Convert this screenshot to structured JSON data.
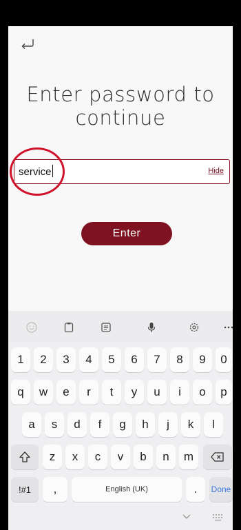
{
  "screen": {
    "title": "Enter password to continue"
  },
  "password_field": {
    "value": "service",
    "toggle_label": "Hide"
  },
  "enter_button": {
    "label": "Enter"
  },
  "keyboard": {
    "toolbar_icons": [
      "emoji-icon",
      "clipboard-icon",
      "notes-icon",
      "mic-icon",
      "settings-icon",
      "more-icon"
    ],
    "row_numbers": [
      "1",
      "2",
      "3",
      "4",
      "5",
      "6",
      "7",
      "8",
      "9",
      "0"
    ],
    "row_q": [
      "q",
      "w",
      "e",
      "r",
      "t",
      "y",
      "u",
      "i",
      "o",
      "p"
    ],
    "row_a": [
      "a",
      "s",
      "d",
      "f",
      "g",
      "h",
      "j",
      "k",
      "l"
    ],
    "row_z": [
      "z",
      "x",
      "c",
      "v",
      "b",
      "n",
      "m"
    ],
    "symbols_label": "!#1",
    "comma_label": ",",
    "space_label": "English (UK)",
    "period_label": ".",
    "done_label": "Done"
  },
  "colors": {
    "brand": "#7e1221",
    "annotation": "#d0122b",
    "done_text": "#3b7be0"
  }
}
